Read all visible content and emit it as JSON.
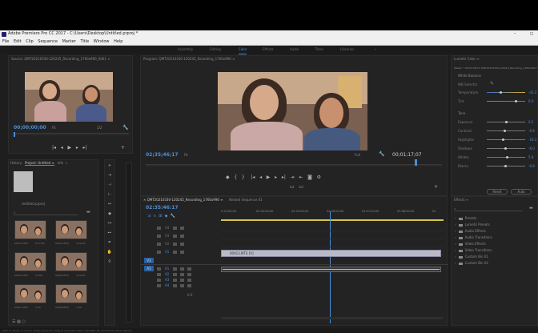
{
  "window": {
    "title": "Adobe Premiere Pro CC 2017 - C:\\Users\\Desktop\\Untitled.prproj *",
    "controls": [
      "–",
      "◻"
    ]
  },
  "menu": [
    "File",
    "Edit",
    "Clip",
    "Sequence",
    "Marker",
    "Title",
    "Window",
    "Help"
  ],
  "workspaces": [
    "Assembly",
    "Editing",
    "Color",
    "Effects",
    "Audio",
    "Titles",
    "Libraries",
    "»"
  ],
  "active_workspace": "Color",
  "source": {
    "title": "Source: QMT20210330-120245_Recording_1760x990_0001 ≡",
    "timecode": "00;00;00;00",
    "fit": "Fit",
    "scale": "1/2"
  },
  "program": {
    "title": "Program: QMT20210330-120245_Recording_1760x990 ≡",
    "timecode": "02;35;46;17",
    "fit": "Fit",
    "full": "Full",
    "duration": "00;01;17;07"
  },
  "project": {
    "tabs": [
      "History",
      "Project: Untitled ≡",
      "Info",
      "»"
    ],
    "file": "Untitled.prproj",
    "items": [
      {
        "name": "00013.MTS",
        "dur": "5;17;00"
      },
      {
        "name": "00014.MTS",
        "dur": "4;00:00"
      },
      {
        "name": "00015.MTS",
        "dur": "13;08"
      },
      {
        "name": "00016.MTS",
        "dur": "4;20;00"
      },
      {
        "name": "00017.MTS",
        "dur": "1;10"
      },
      {
        "name": "00018.MTS",
        "dur": "7;00"
      }
    ]
  },
  "timeline": {
    "tabs": [
      "× QMT20210330-120245_Recording_1760x990 ≡",
      "Nested Sequence 01"
    ],
    "timecode": "02:35:46:17",
    "ruler": [
      "2:33:00:00",
      "02:34:00:00",
      "02:35:00:00",
      "02:36:00:00",
      "02:37:00:00",
      "02:38:00:00",
      "02"
    ],
    "video_tracks": [
      "V4",
      "V3",
      "V2",
      "V1"
    ],
    "audio_tracks": [
      "A1",
      "A2",
      "A3",
      "A4"
    ],
    "clip_label": "00013.MTS [V]",
    "src_v": "V1",
    "src_a": "A1",
    "mix_value": "0.0"
  },
  "lumetri": {
    "title": "Lumetri Color ≡",
    "master": "Master * 00013.MTS ▾  QMT20210330-120245_Recording_1760x990 * 00013...",
    "wb_section": "White Balance",
    "wb_selector": "WB Selector",
    "wb_rows": [
      {
        "label": "Temperature",
        "value": "-41.2",
        "pos": 0.35
      },
      {
        "label": "Tint",
        "value": "0.0",
        "pos": 0.75
      }
    ],
    "tone_section": "Tone",
    "tone_rows": [
      {
        "label": "Exposure",
        "value": "0.2",
        "pos": 0.5
      },
      {
        "label": "Contrast",
        "value": "-9.4",
        "pos": 0.45
      },
      {
        "label": "Highlights",
        "value": "-16.3",
        "pos": 0.42
      },
      {
        "label": "Shadows",
        "value": "-6.0",
        "pos": 0.48
      },
      {
        "label": "Whites",
        "value": "5.8",
        "pos": 0.52
      },
      {
        "label": "Blacks",
        "value": "-6.8",
        "pos": 0.48
      }
    ],
    "buttons": [
      "Reset",
      "Auto"
    ]
  },
  "effects": {
    "title": "Effects ≡",
    "folders": [
      "Presets",
      "Lumetri Presets",
      "Audio Effects",
      "Audio Transitions",
      "Video Effects",
      "Video Transitions",
      "Custom Bin 01",
      "Custom Bin 02"
    ]
  },
  "status": "Click to select, or click in empty space and drag to marquee select. Use Shift, Alt, and Ctrl for other options.",
  "colors": {
    "accent": "#4a8fd9",
    "timeline_bar": "#d7c54a"
  }
}
